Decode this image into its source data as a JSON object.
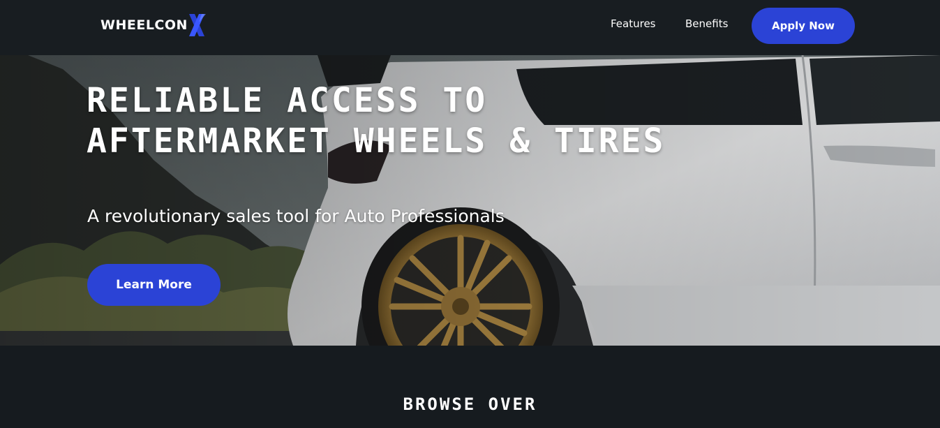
{
  "nav": {
    "logo_text": "WHEELCON",
    "logo_icon": "stylized-x-logo",
    "links": [
      "Features",
      "Benefits"
    ],
    "cta_label": "Apply Now"
  },
  "hero": {
    "title": "RELIABLE ACCESS TO AFTERMARKET WHEELS & TIRES",
    "subtitle": "A revolutionary sales tool for Auto Professionals",
    "cta_label": "Learn More",
    "background_image": "white-car-with-gold-wheels-photo"
  },
  "browse": {
    "heading": "BROWSE OVER"
  },
  "colors": {
    "accent": "#2b43d6",
    "nav_bg": "#181d21",
    "page_bg": "#161b1f",
    "wheel_gold": "#a8803a",
    "text": "#ffffff"
  }
}
